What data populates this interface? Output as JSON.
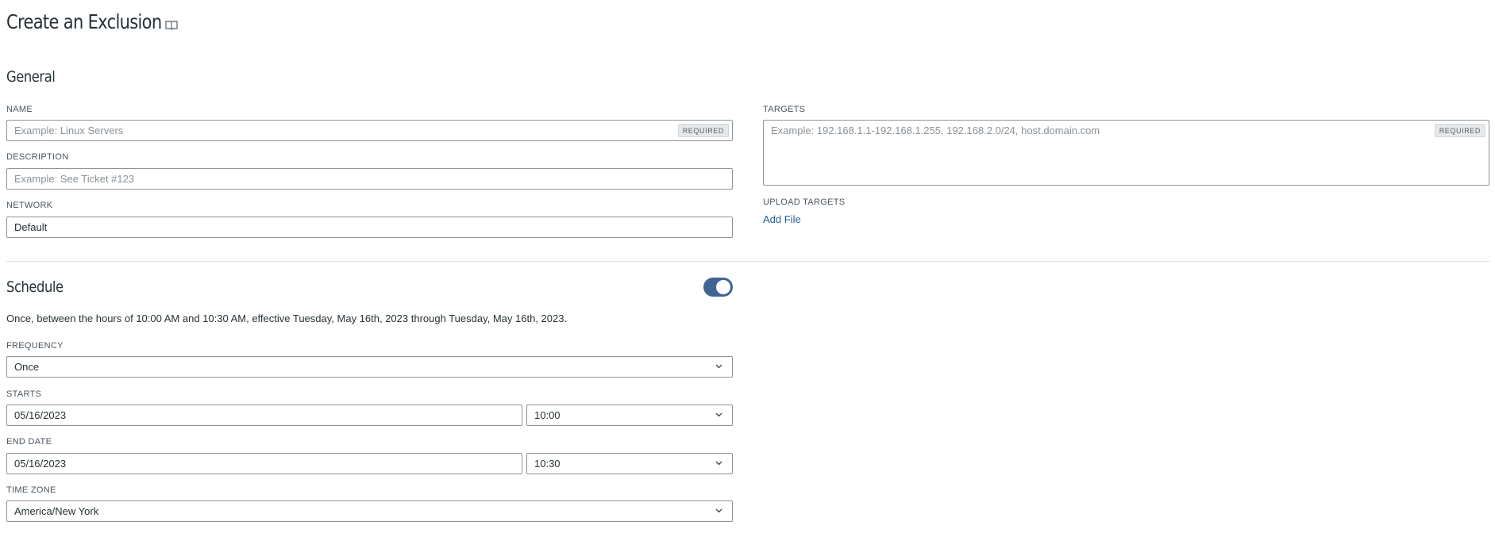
{
  "page": {
    "title": "Create an Exclusion",
    "title_icon": "book-icon"
  },
  "general": {
    "heading": "General",
    "name": {
      "label": "NAME",
      "placeholder": "Example: Linux Servers",
      "required_tag": "REQUIRED"
    },
    "description": {
      "label": "DESCRIPTION",
      "placeholder": "Example: See Ticket #123"
    },
    "network": {
      "label": "NETWORK",
      "value": "Default"
    },
    "targets": {
      "label": "TARGETS",
      "placeholder": "Example: 192.168.1.1-192.168.1.255, 192.168.2.0/24, host.domain.com",
      "required_tag": "REQUIRED"
    },
    "upload_targets": {
      "label": "UPLOAD TARGETS",
      "link": "Add File"
    }
  },
  "schedule": {
    "heading": "Schedule",
    "enabled": true,
    "summary": "Once, between the hours of 10:00 AM and 10:30 AM, effective Tuesday, May 16th, 2023 through Tuesday, May 16th, 2023.",
    "frequency": {
      "label": "FREQUENCY",
      "value": "Once"
    },
    "starts": {
      "label": "STARTS",
      "date": "05/16/2023",
      "time": "10:00"
    },
    "end_date": {
      "label": "END DATE",
      "date": "05/16/2023",
      "time": "10:30"
    },
    "time_zone": {
      "label": "TIME ZONE",
      "value": "America/New York"
    }
  },
  "colors": {
    "accent": "#3d6494",
    "link": "#1f5f99",
    "border": "#8c959c",
    "text": "#263238"
  }
}
